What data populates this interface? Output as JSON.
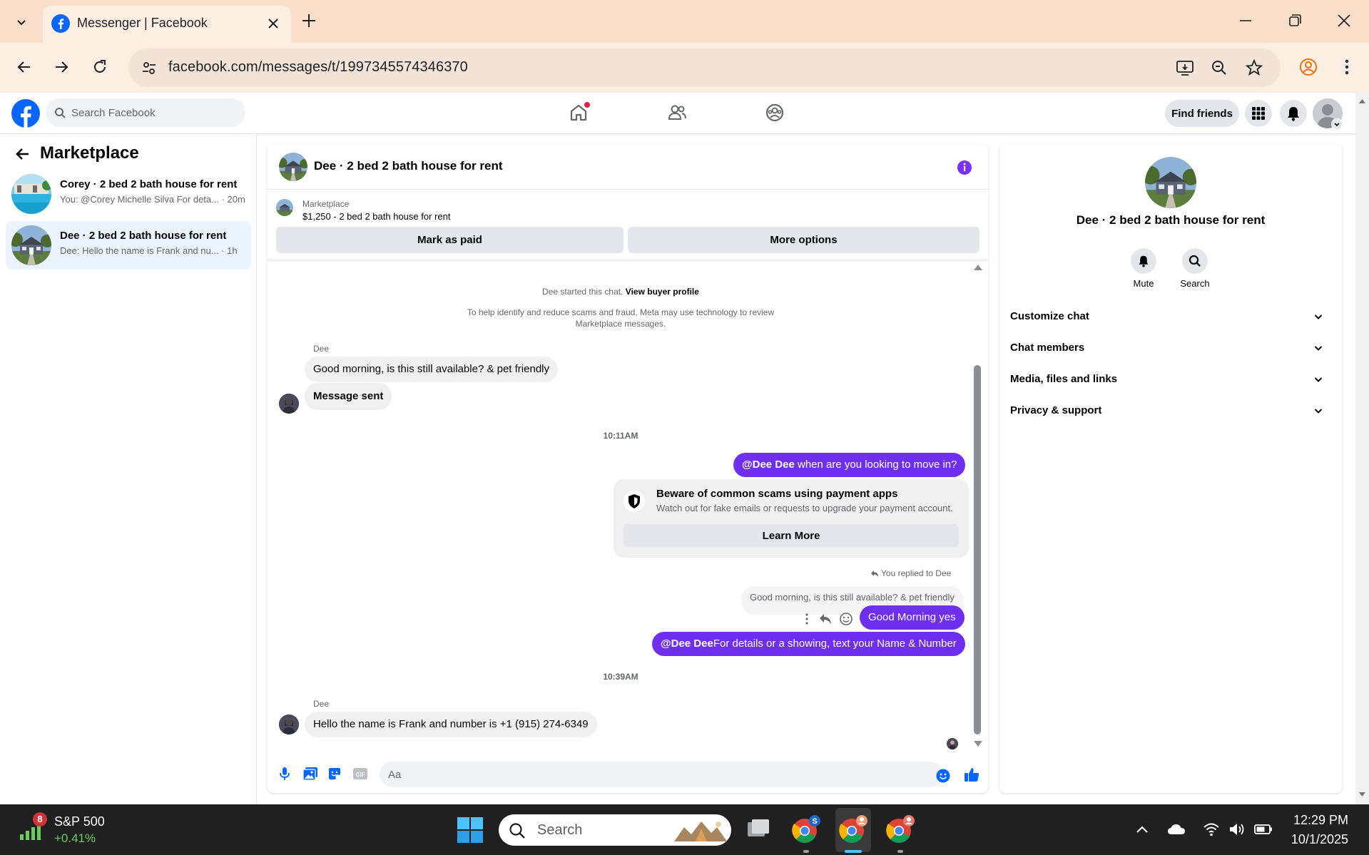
{
  "browser": {
    "tab_title": "Messenger | Facebook",
    "url": "facebook.com/messages/t/1997345574346370"
  },
  "fb": {
    "search_placeholder": "Search Facebook",
    "find_friends": "Find friends"
  },
  "sidebar": {
    "title": "Marketplace",
    "conversations": [
      {
        "name": "Corey · 2 bed 2 bath house for rent",
        "preview": "You: @Corey Michelle Silva For deta... · 20m"
      },
      {
        "name": "Dee · 2 bed 2 bath house for rent",
        "preview": "Dee: Hello the name is Frank and nu... · 1h"
      }
    ]
  },
  "chat": {
    "title": "Dee · 2 bed 2 bath house for rent",
    "marketplace_label": "Marketplace",
    "listing": "$1,250 - 2 bed 2 bath house for rent",
    "mark_paid": "Mark as paid",
    "more_options": "More options",
    "started_text": "Dee started this chat. ",
    "view_profile": "View buyer profile",
    "notice_line1": "To help identify and reduce scams and fraud, Meta may use technology to review",
    "notice_line2": "Marketplace messages.",
    "sender_name": "Dee",
    "msg1": "Good morning, is this still available? & pet friendly",
    "msg2": "Message sent",
    "time1": "10:11AM",
    "out1_mention": "@Dee Dee",
    "out1_text": " when are you looking to move in?",
    "scam_title": "Beware of common scams using payment apps",
    "scam_sub": "Watch out for fake emails or requests to upgrade your payment account.",
    "learn_more": "Learn More",
    "replied_label": "You replied to Dee",
    "reply_quote": "Good morning, is this still available? & pet friendly",
    "out2": "Good Morning yes",
    "out3_mention": "@Dee Dee",
    "out3_text": "For details or a showing, text your Name & Number",
    "time2": "10:39AM",
    "msg3": "Hello the name is Frank and number is +1 (915) 274-6349",
    "input_placeholder": "Aa"
  },
  "info_panel": {
    "title": "Dee · 2 bed 2 bath house for rent",
    "mute": "Mute",
    "search": "Search",
    "sections": [
      "Customize chat",
      "Chat members",
      "Media, files and links",
      "Privacy & support"
    ]
  },
  "taskbar": {
    "stock_badge": "8",
    "stock_name": "S&P 500",
    "stock_change": "+0.41%",
    "search_placeholder": "Search",
    "time": "12:29 PM",
    "date": "10/1/2025"
  },
  "colors": {
    "accent_purple": "#6f2ff0",
    "fb_blue": "#0866ff",
    "active_conv": "#ebf5ff"
  }
}
